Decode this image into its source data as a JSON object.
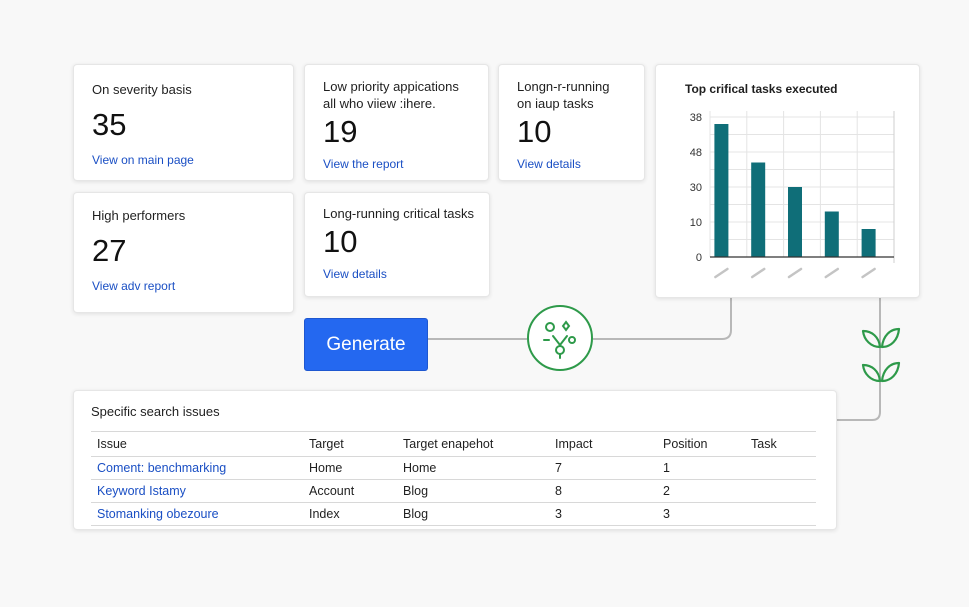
{
  "cards": {
    "severity": {
      "title": "On severity basis",
      "value": "35",
      "link": "View on main page"
    },
    "low_priority": {
      "title_line1": "Low priority appications",
      "title_line2": "all who viiew :ihere.",
      "value": "19",
      "link": "View the report"
    },
    "long_running_top": {
      "title_line1": "Longn-r-running",
      "title_line2": "on iaup tasks",
      "value": "10",
      "link": "View details"
    },
    "high_performers": {
      "title": "High performers",
      "value": "27",
      "link": "View adv report"
    },
    "long_running_critical": {
      "title": "Long-running critical tasks",
      "value": "10",
      "link": "View details"
    }
  },
  "generate_button": {
    "label": "Generate"
  },
  "colors": {
    "accent": "#2468f0",
    "bar": "#0f6e78",
    "node": "#2e9a4a",
    "link": "#1a4fc4"
  },
  "chart_data": {
    "type": "bar",
    "title": "Top crifical tasks executed",
    "categories": [
      "",
      "",
      "",
      "",
      ""
    ],
    "values": [
      38,
      27,
      20,
      13,
      8
    ],
    "ytick_values": [
      0,
      10,
      20,
      30,
      40
    ],
    "ytick_labels": [
      "0",
      "10",
      "30",
      "48",
      "38"
    ],
    "ylim": [
      0,
      40
    ],
    "grid": true,
    "xlabel": "",
    "ylabel": ""
  },
  "table": {
    "title": "Specific search issues",
    "columns": [
      "Issue",
      "Target",
      "Target enapehot",
      "Impact",
      "Position",
      "Task"
    ],
    "rows": [
      [
        "Coment: benchmarking",
        "Home",
        "Home",
        "7",
        "1",
        ""
      ],
      [
        "Keyword Istamy",
        "Account",
        "Blog",
        "8",
        "2",
        ""
      ],
      [
        "Stomanking obezoure",
        "Index",
        "Blog",
        "3",
        "3",
        ""
      ]
    ]
  },
  "icons": {
    "node": "workflow-node-icon",
    "sprout": "sprout-icon"
  }
}
